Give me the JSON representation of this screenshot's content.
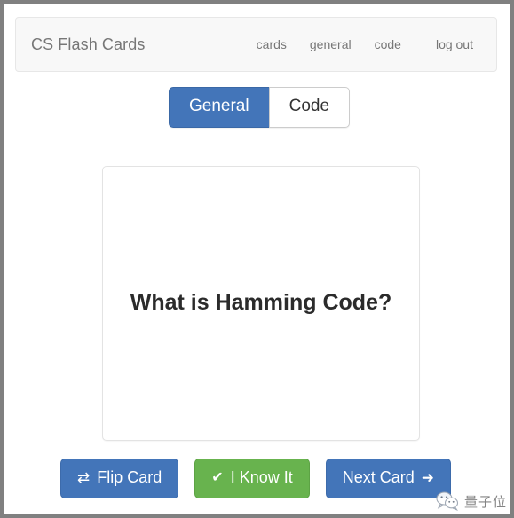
{
  "window": {
    "frame_color": "#808080",
    "background": "#ffffff"
  },
  "navbar": {
    "brand": "CS Flash Cards",
    "links": [
      {
        "label": "cards"
      },
      {
        "label": "general"
      },
      {
        "label": "code"
      },
      {
        "label": "log out"
      }
    ]
  },
  "toggle": {
    "active_color": "#4375b9",
    "tabs": [
      {
        "label": "General",
        "active": true
      },
      {
        "label": "Code",
        "active": false
      }
    ]
  },
  "card": {
    "question": "What is Hamming Code?"
  },
  "actions": {
    "flip": {
      "label": "Flip Card",
      "icon": "⇄",
      "icon_name": "swap-horizontal-icon",
      "color": "#4375b9"
    },
    "know": {
      "label": "I Know It",
      "icon": "✔",
      "icon_name": "check-icon",
      "color": "#68b34e"
    },
    "next": {
      "label": "Next Card",
      "icon": "➜",
      "icon_name": "arrow-right-icon",
      "color": "#4375b9"
    }
  },
  "watermark": {
    "text": "量子位",
    "icon_name": "wechat-icon"
  }
}
